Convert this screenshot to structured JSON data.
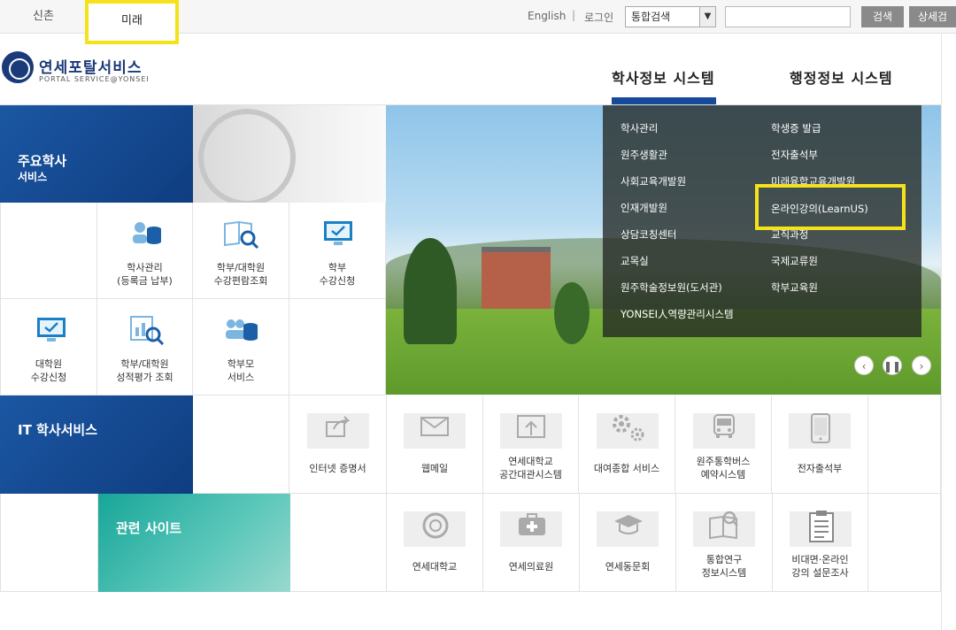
{
  "topbar": {
    "campus_sinchon": "신촌",
    "campus_mirae": "미래",
    "english": "English",
    "separator": "|",
    "login": "로그인",
    "search_select": "통합검색",
    "search_button": "검색",
    "detail_button": "상세검"
  },
  "header": {
    "logo_title": "연세포탈서비스",
    "logo_sub": "PORTAL SERVICE@YONSEI",
    "nav_academic": "학사정보 시스템",
    "nav_admin": "행정정보 시스템"
  },
  "academic": {
    "title": "주요학사",
    "subtitle": "서비스",
    "items": [
      {
        "line1": "학사관리",
        "line2": "(등록금 납부)"
      },
      {
        "line1": "학부/대학원",
        "line2": "수강편람조회"
      },
      {
        "line1": "학부",
        "line2": "수강신청"
      },
      {
        "line1": "대학원",
        "line2": "수강신청"
      },
      {
        "line1": "학부/대학원",
        "line2": "성적평가 조회"
      },
      {
        "line1": "학부모",
        "line2": "서비스"
      }
    ]
  },
  "banner_menu": {
    "left": [
      "학사관리",
      "원주생활관",
      "사회교육개발원",
      "인재개발원",
      "상담코칭센터",
      "교목실",
      "원주학술정보원(도서관)",
      "YONSEI人역량관리시스템"
    ],
    "right": [
      "학생증 발급",
      "전자출석부",
      "미래융합교육개발원",
      "온라인강의(LearnUS)",
      "교직과정",
      "국제교류원",
      "학부교육원"
    ]
  },
  "it": {
    "title": "IT 학사서비스",
    "items": [
      {
        "line1": "인터넷 증명서",
        "line2": ""
      },
      {
        "line1": "웹메일",
        "line2": ""
      },
      {
        "line1": "연세대학교",
        "line2": "공간대관시스템"
      },
      {
        "line1": "대여종합 서비스",
        "line2": ""
      },
      {
        "line1": "원주통학버스",
        "line2": "예약시스템"
      },
      {
        "line1": "전자출석부",
        "line2": ""
      }
    ]
  },
  "related": {
    "title": "관련 사이트",
    "items": [
      {
        "line1": "연세대학교",
        "line2": ""
      },
      {
        "line1": "연세의료원",
        "line2": ""
      },
      {
        "line1": "연세동문회",
        "line2": ""
      },
      {
        "line1": "통합연구",
        "line2": "정보시스템"
      },
      {
        "line1": "비대면·온라인",
        "line2": "강의 설문조사"
      }
    ]
  },
  "colors": {
    "accent_blue": "#174a9b",
    "highlight": "#f5e21b",
    "teal": "#1aa99a"
  }
}
